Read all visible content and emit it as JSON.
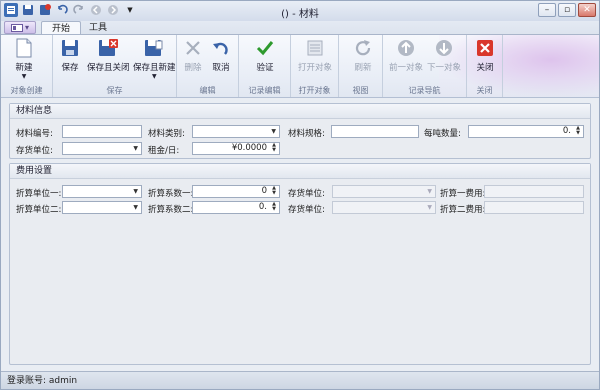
{
  "window": {
    "title": "() - 材料"
  },
  "tabs": {
    "file_label": "",
    "start": "开始",
    "tools": "工具"
  },
  "ribbon": {
    "groups": {
      "create": "对象创建",
      "save": "保存",
      "edit": "编辑",
      "record_edit": "记录编辑",
      "open_object": "打开对象",
      "view": "视图",
      "record_nav": "记录导航",
      "close": "关闭"
    },
    "buttons": {
      "new": "新建",
      "save": "保存",
      "save_close": "保存且关闭",
      "save_new": "保存且新建",
      "delete": "删除",
      "cancel": "取消",
      "validate": "验证",
      "open_object": "打开对象",
      "refresh": "刷新",
      "prev_object": "前一对象",
      "next_object": "下一对象",
      "close": "关闭"
    }
  },
  "material_info": {
    "title": "材料信息",
    "code_label": "材料编号:",
    "code_value": "",
    "category_label": "材料类别:",
    "category_value": "",
    "spec_label": "材料规格:",
    "spec_value": "",
    "weight_label": "每吨数量:",
    "weight_value": "0.",
    "stock_unit_label": "存货单位:",
    "stock_unit_value": "",
    "rent_label": "租金/日:",
    "rent_value": "¥0.0000"
  },
  "cost_settings": {
    "title": "费用设置",
    "conv_unit1_label": "折算单位一:",
    "conv_unit1_value": "",
    "conv_factor1_label": "折算系数一:",
    "conv_factor1_value": "0",
    "stock_unit1_label": "存货单位:",
    "stock_unit1_value": "",
    "conv_cost1_label": "折算一费用:",
    "conv_cost1_value": "",
    "conv_unit2_label": "折算单位二:",
    "conv_unit2_value": "",
    "conv_factor2_label": "折算系数二:",
    "conv_factor2_value": "0.",
    "stock_unit2_label": "存货单位:",
    "stock_unit2_value": "",
    "conv_cost2_label": "折算二费用:",
    "conv_cost2_value": ""
  },
  "status": {
    "login_label": "登录账号:",
    "login_value": "admin"
  },
  "colors": {
    "accent_red": "#d9372b",
    "accent_green": "#2e9a2e",
    "ribbon_purple": "#d8c3ea"
  }
}
